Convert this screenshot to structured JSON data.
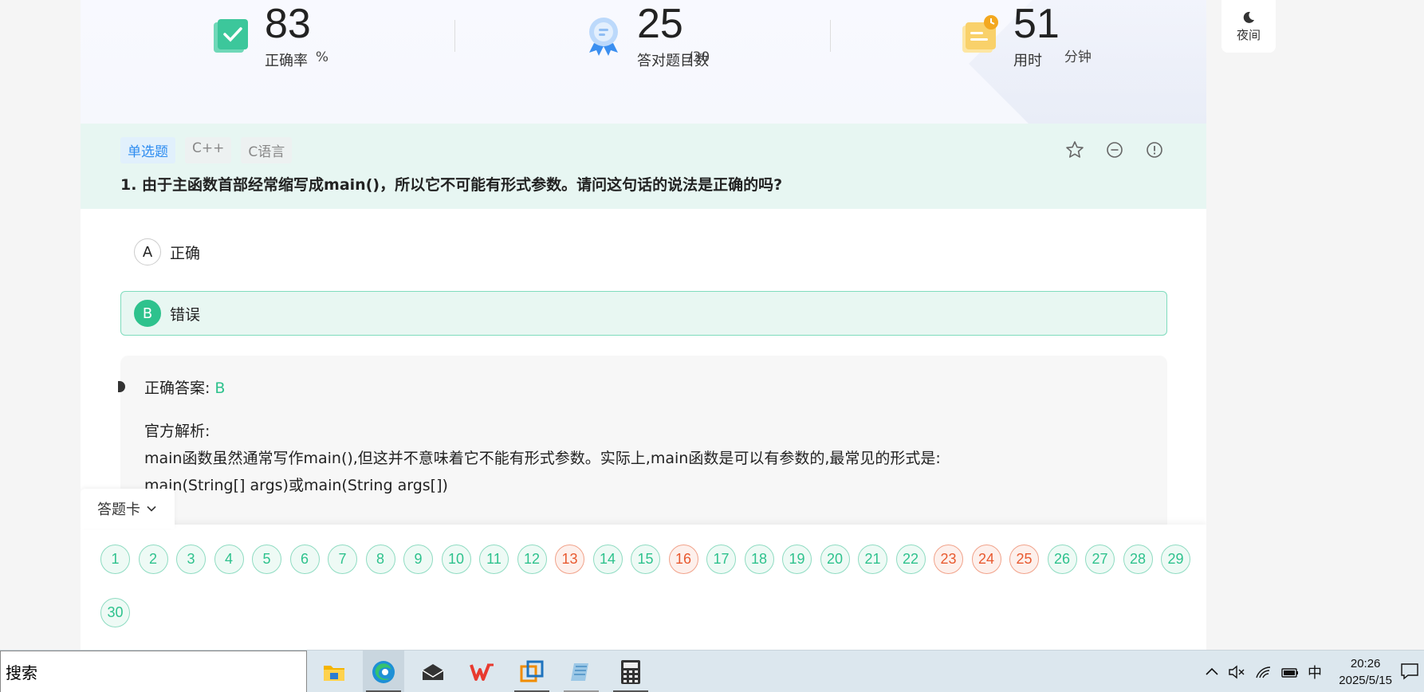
{
  "stats": {
    "accuracy": {
      "value": "83",
      "unit": "%",
      "label": "正确率"
    },
    "correct_count": {
      "value": "25",
      "unit": "/30",
      "label": "答对题目数"
    },
    "time_used": {
      "value": "51",
      "unit": "分钟",
      "label": "用时"
    }
  },
  "night_mode": {
    "label": "夜间"
  },
  "question": {
    "tags": [
      "单选题",
      "C++",
      "C语言"
    ],
    "title": "1. 由于主函数首部经常缩写成main()，所以它不可能有形式参数。请问这句话的说法是正确的吗?",
    "tools": [
      "star-icon",
      "minus-circle-icon",
      "info-circle-icon"
    ],
    "options": [
      {
        "letter": "A",
        "text": "正确",
        "state": "normal"
      },
      {
        "letter": "B",
        "text": "错误",
        "state": "correct"
      }
    ]
  },
  "explanation": {
    "answer_label": "正确答案:",
    "answer_value": "B",
    "title": "官方解析:",
    "lines": [
      "main函数虽然通常写作main(),但这并不意味着它不能有形式参数。实际上,main函数是可以有参数的,最常见的形式是:",
      "main(String[] args)或main(String args[])"
    ]
  },
  "answer_card": {
    "label": "答题卡",
    "numbers": [
      "1",
      "2",
      "3",
      "4",
      "5",
      "6",
      "7",
      "8",
      "9",
      "10",
      "11",
      "12",
      "13",
      "14",
      "15",
      "16",
      "17",
      "18",
      "19",
      "20",
      "21",
      "22",
      "23",
      "24",
      "25",
      "26",
      "27",
      "28",
      "29",
      "30"
    ],
    "wrong": [
      "13",
      "16",
      "23",
      "24",
      "25"
    ]
  },
  "colors": {
    "correct": "#2ec28d",
    "wrong": "#e8592f",
    "tag_blue": "#2d8cf0"
  },
  "taskbar": {
    "search_text": "搜索",
    "apps": [
      "file-explorer-icon",
      "edge-icon",
      "mail-icon",
      "wps-icon",
      "remote-desktop-icon",
      "notepad-icon",
      "calculator-icon"
    ],
    "tray": {
      "ime": "中"
    },
    "time": "20:26",
    "date": "2025/5/15"
  }
}
